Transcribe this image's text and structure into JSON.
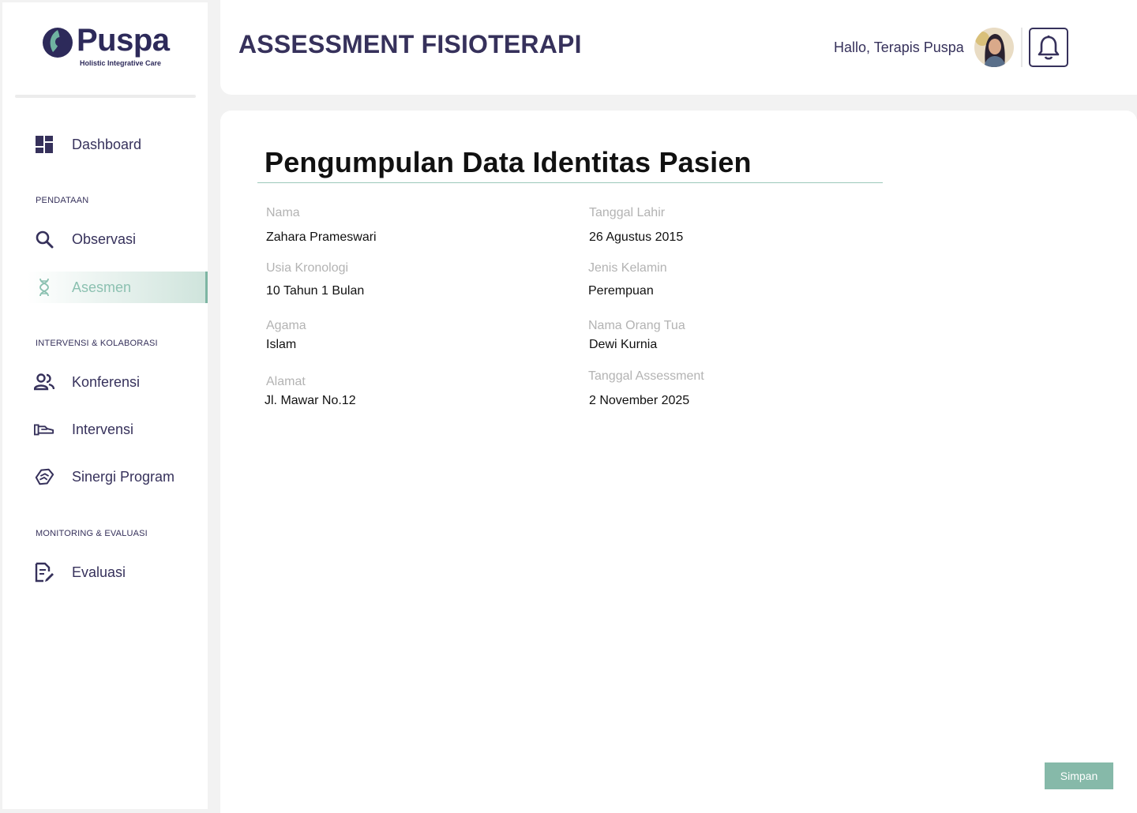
{
  "brand": {
    "name": "Puspa",
    "tagline": "Holistic Integrative Care"
  },
  "header": {
    "title": "ASSESSMENT FISIOTERAPI",
    "greeting": "Hallo, Terapis Puspa"
  },
  "sidebar": {
    "dashboard": {
      "label": "Dashboard",
      "icon": "dashboard-icon"
    },
    "section_pendataan": "PENDATAAN",
    "observasi": {
      "label": "Observasi",
      "icon": "search-icon"
    },
    "asesmen": {
      "label": "Asesmen",
      "icon": "dna-icon",
      "active": true
    },
    "section_intervensi": "INTERVENSI & KOLABORASI",
    "konferensi": {
      "label": "Konferensi",
      "icon": "people-icon"
    },
    "intervensi": {
      "label": "Intervensi",
      "icon": "hand-icon"
    },
    "sinergi": {
      "label": "Sinergi Program",
      "icon": "handshake-icon"
    },
    "section_monitoring": "MONITORING & EVALUASI",
    "evaluasi": {
      "label": "Evaluasi",
      "icon": "document-edit-icon"
    }
  },
  "form": {
    "title": "Pengumpulan Data Identitas Pasien",
    "fields": {
      "nama": {
        "label": "Nama",
        "value": "Zahara Prameswari"
      },
      "tanggal_lahir": {
        "label": "Tanggal Lahir",
        "value": "26 Agustus 2015"
      },
      "usia": {
        "label": "Usia Kronologi",
        "value": "10 Tahun 1 Bulan"
      },
      "jenis_kelamin": {
        "label": "Jenis Kelamin",
        "value": "Perempuan"
      },
      "agama": {
        "label": "Agama",
        "value": "Islam"
      },
      "orang_tua": {
        "label": "Nama Orang Tua",
        "value": "Dewi Kurnia"
      },
      "alamat": {
        "label": "Alamat",
        "value": "Jl. Mawar No.12"
      },
      "tanggal_assessment": {
        "label": "Tanggal Assessment",
        "value": "2 November 2025"
      }
    },
    "save_label": "Simpan"
  },
  "colors": {
    "primary": "#36315b",
    "accent": "#86b9a9",
    "active_text": "#8cc1b1"
  }
}
